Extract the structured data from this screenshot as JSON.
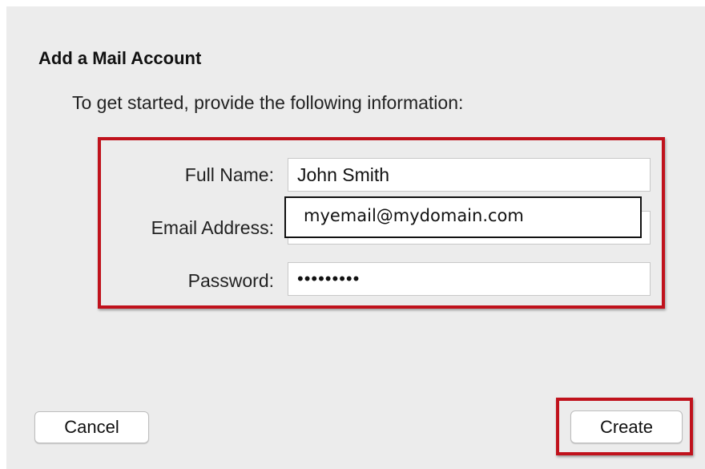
{
  "dialog": {
    "title": "Add a Mail Account",
    "subtitle": "To get started, provide the following information:"
  },
  "fields": {
    "full_name": {
      "label": "Full Name:",
      "value": "John Smith"
    },
    "email": {
      "label": "Email Address:",
      "value": "myemail@mydomain.com"
    },
    "password": {
      "label": "Password:",
      "value": "•••••••••"
    }
  },
  "buttons": {
    "cancel_label": "Cancel",
    "create_label": "Create"
  },
  "colors": {
    "highlight": "#c0121c",
    "dialog_background": "#ececec"
  }
}
